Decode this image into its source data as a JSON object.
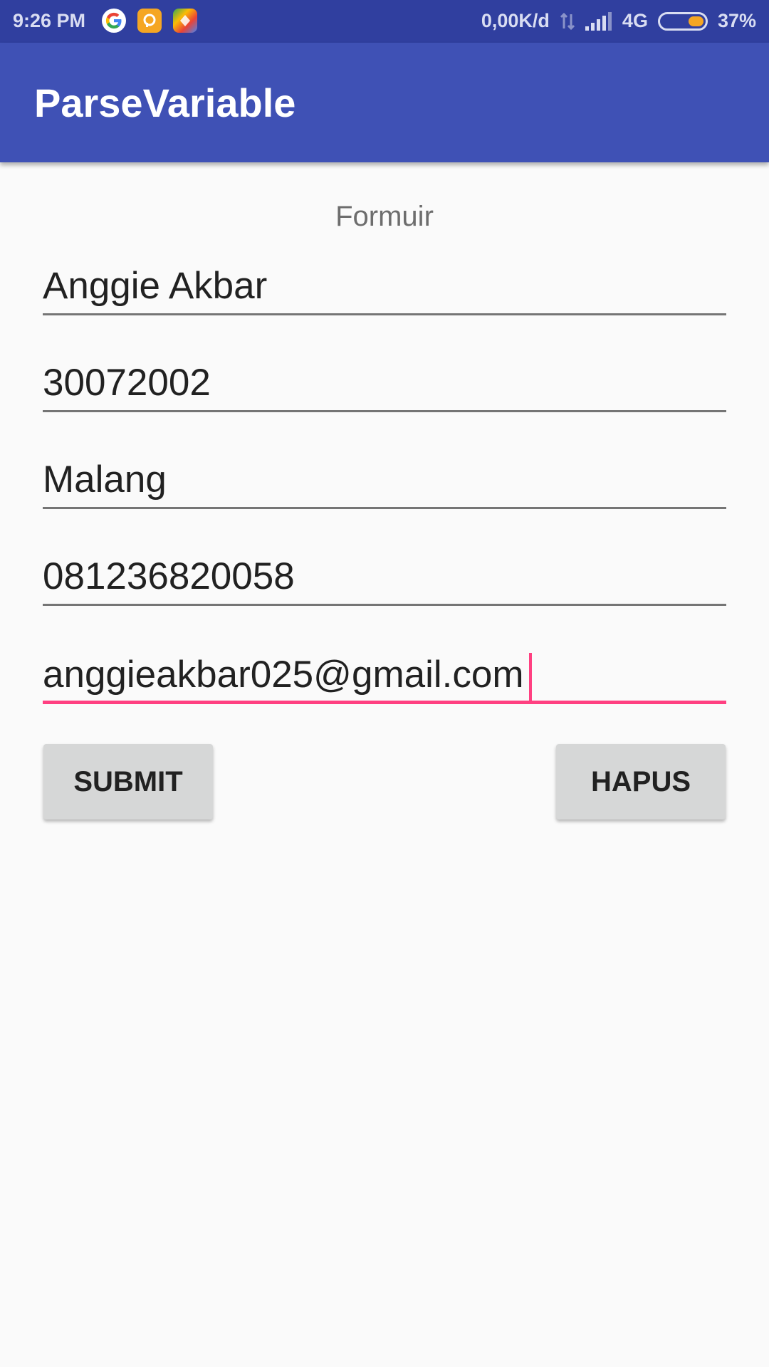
{
  "status_bar": {
    "time": "9:26 PM",
    "network_speed": "0,00K/d",
    "network_type": "4G",
    "battery": "37%",
    "battery_level": 0.37,
    "icons": [
      "google-icon",
      "orange-app-icon",
      "maps-icon",
      "data-transfer-icon",
      "signal-icon",
      "battery-icon"
    ]
  },
  "app_bar": {
    "title": "ParseVariable",
    "color": "#3f51b5"
  },
  "form": {
    "heading": "Formuir",
    "fields": [
      {
        "value": "Anggie Akbar"
      },
      {
        "value": "30072002"
      },
      {
        "value": "Malang"
      },
      {
        "value": "081236820058"
      },
      {
        "value": "anggieakbar025@gmail.com",
        "focused": true
      }
    ],
    "accent_color": "#ff4081"
  },
  "buttons": {
    "submit_label": "SUBMIT",
    "clear_label": "HAPUS"
  }
}
